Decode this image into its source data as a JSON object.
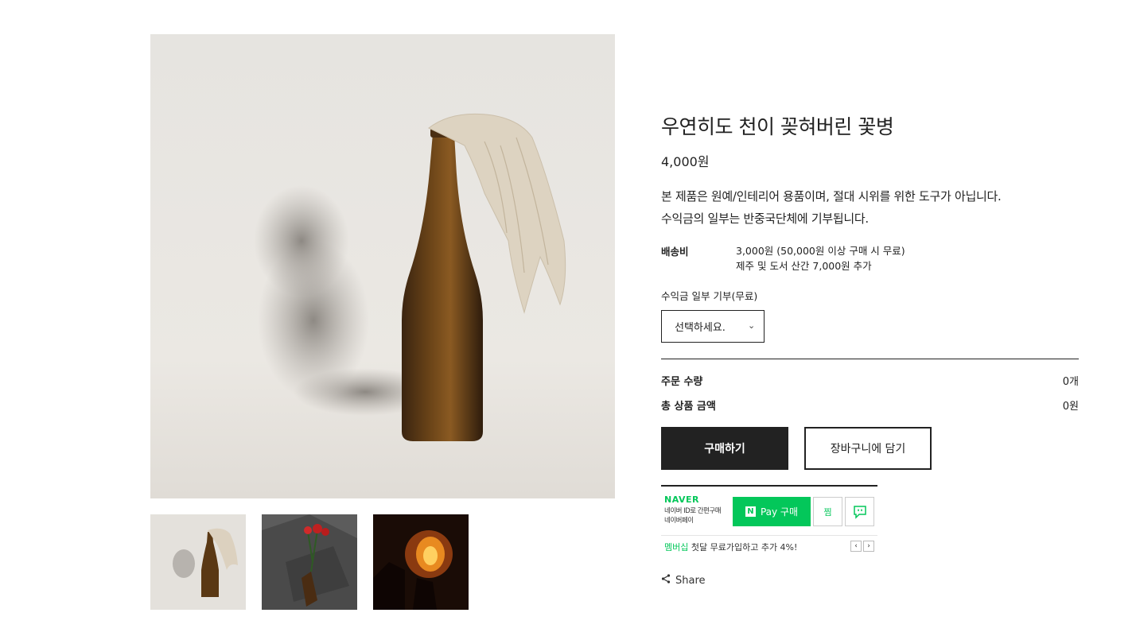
{
  "product": {
    "title": "우연히도 천이 꽂혀버린 꽃병",
    "price": "4,000원",
    "description_line1": "본 제품은 원예/인테리어 용품이며, 절대 시위를 위한 도구가 아닙니다.",
    "description_line2": "수익금의 일부는 반중국단체에 기부됩니다."
  },
  "shipping": {
    "label": "배송비",
    "line1": "3,000원 (50,000원 이상 구매 시 무료)",
    "line2": "제주 및 도서 산간 7,000원 추가"
  },
  "option": {
    "label": "수익금 일부 기부(무료)",
    "selected": "선택하세요.",
    "chevron_icon": "chevron-down-icon"
  },
  "summary": {
    "quantity_label": "주문 수량",
    "quantity_value": "0개",
    "total_label": "총 상품 금액",
    "total_value": "0원"
  },
  "buttons": {
    "buy": "구매하기",
    "cart": "장바구니에 담기"
  },
  "naverpay": {
    "brand": "NAVER",
    "sub_line1": "네이버 ID로 간편구매",
    "sub_line2": "네이버페이",
    "pay_n": "N",
    "pay_label": "Pay 구매",
    "wish_label": "찜",
    "talk_icon": "talk-icon",
    "promo_highlight": "멤버십",
    "promo_text": " 첫달 무료가입하고 추가 4%!",
    "prev": "‹",
    "next": "›",
    "color": "#03c75a"
  },
  "share": {
    "label": "Share",
    "icon": "share-icon"
  }
}
